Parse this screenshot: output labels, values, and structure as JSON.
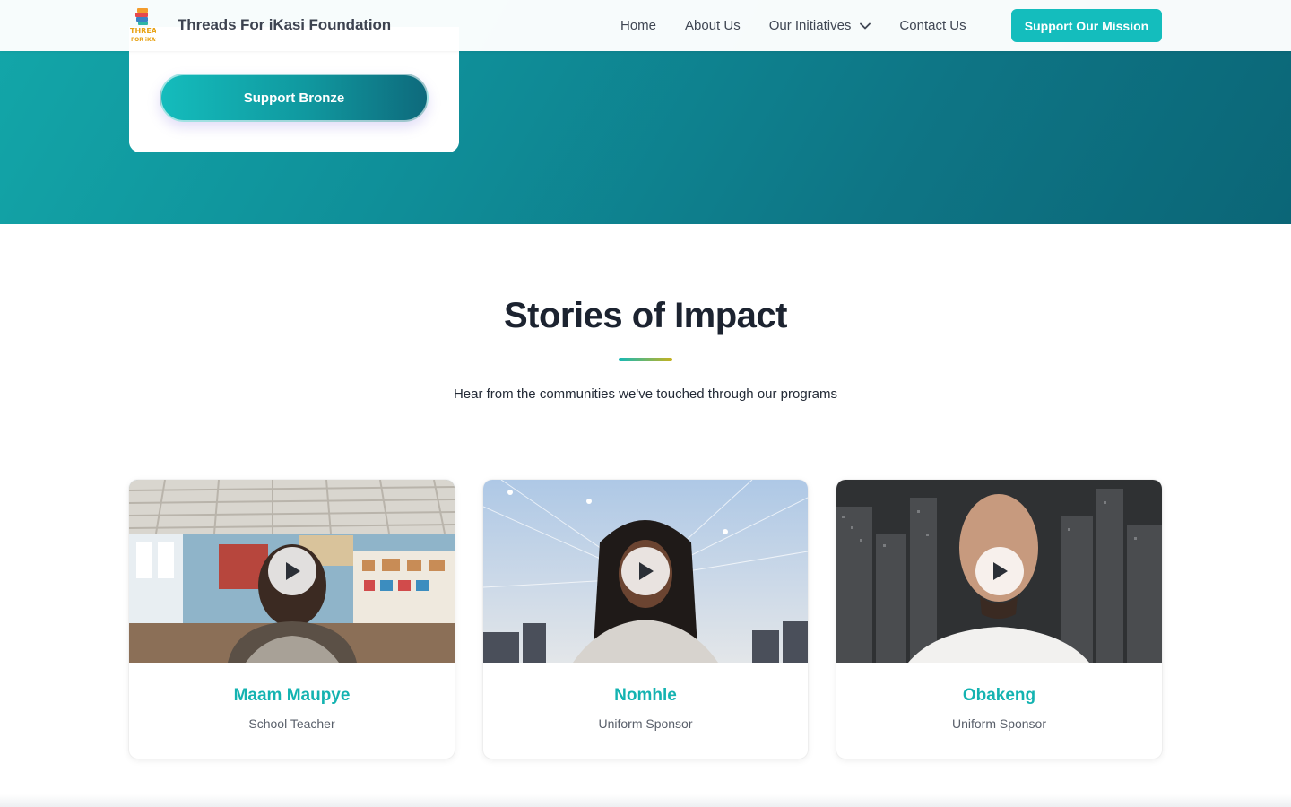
{
  "header": {
    "brand_name": "Threads For iKasi Foundation",
    "logo_icon": "threads-logo-icon",
    "nav": [
      {
        "label": "Home"
      },
      {
        "label": "About Us"
      },
      {
        "label": "Our Initiatives",
        "has_dropdown": true
      },
      {
        "label": "Contact Us"
      }
    ],
    "cta_label": "Support Our Mission"
  },
  "hero": {
    "tier_button_label": "Support Bronze"
  },
  "stories": {
    "title": "Stories of Impact",
    "subtitle": "Hear from the communities we've touched through our programs",
    "cards": [
      {
        "name": "Maam Maupye",
        "role": "School Teacher",
        "media_icon": "play-icon"
      },
      {
        "name": "Nomhle",
        "role": "Uniform Sponsor",
        "media_icon": "play-icon"
      },
      {
        "name": "Obakeng",
        "role": "Uniform Sponsor",
        "media_icon": "play-icon"
      }
    ]
  },
  "colors": {
    "accent": "#14bdbd",
    "hero_start": "#13a7a9",
    "hero_end": "#0b6677",
    "name_color": "#14b3b1",
    "title_bar_start": "#16b9b6",
    "title_bar_end": "#c7b21f"
  }
}
